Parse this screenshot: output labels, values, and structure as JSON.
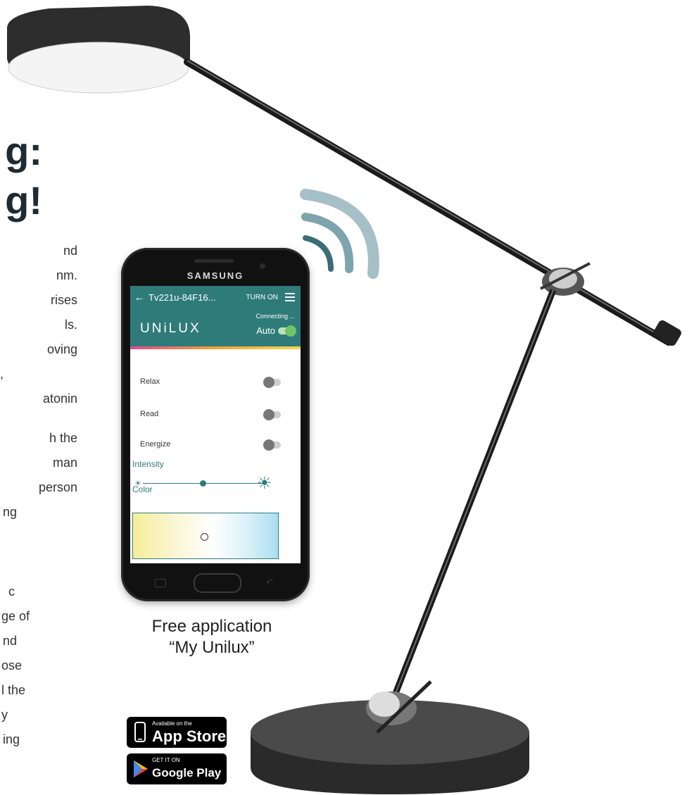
{
  "headline": [
    "g:",
    "g!"
  ],
  "body_fragments": [
    "nd",
    "nm.",
    "rises",
    "ls.",
    "oving",
    ",",
    "atonin",
    "h the",
    "man",
    "person",
    "ng",
    "c",
    "ge of",
    "nd",
    "ose",
    "l the",
    "y",
    "ing"
  ],
  "phone": {
    "brand": "SAMSUNG",
    "device_name": "Tv221u-84F16...",
    "turn_on": "TURN ON",
    "logo": "UNiLUX",
    "status": "Connecting ...",
    "auto_label": "Auto",
    "auto_on": true,
    "modes": [
      {
        "label": "Relax",
        "on": false
      },
      {
        "label": "Read",
        "on": false
      },
      {
        "label": "Energize",
        "on": false
      }
    ],
    "intensity_label": "Intensity",
    "intensity_value": 0.5,
    "color_label": "Color"
  },
  "caption": {
    "line1": "Free application",
    "line2": "“My Unilux”"
  },
  "stores": {
    "appstore_small": "Available on the",
    "appstore_big": "App Store",
    "play_small": "GET IT ON",
    "play_big": "Google Play"
  },
  "colors": {
    "teal": "#2f7b7a",
    "wave": "#8aaeb8"
  }
}
